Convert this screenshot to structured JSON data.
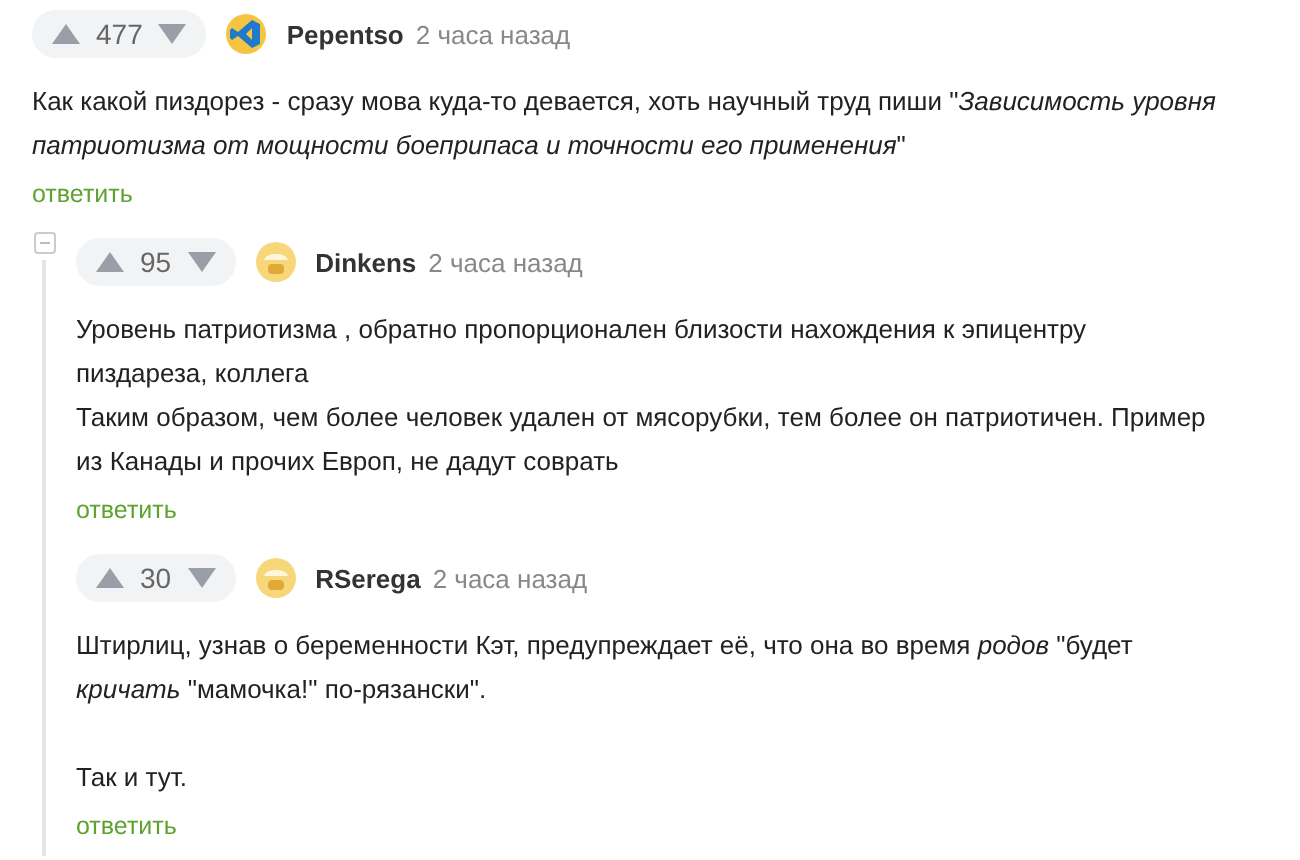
{
  "comments": [
    {
      "rating": "477",
      "author": "Pepentso",
      "avatar": {
        "kind": "code"
      },
      "time": "2 часа назад",
      "paragraphs": [
        {
          "text": "Как какой пиздорез - сразу мова куда-то девается, хоть научный труд пиши \"*Зависимость уровня патриотизма от мощности боеприпаса и точности его применения*\""
        }
      ],
      "reply": "ответить",
      "children": [
        {
          "rating": "95",
          "author": "Dinkens",
          "avatar": {
            "kind": "face"
          },
          "time": "2 часа назад",
          "paragraphs": [
            {
              "text": "Уровень патриотизма , обратно пропорционален близости нахождения к эпицентру пиздареза, коллега"
            },
            {
              "text": "Таким образом, чем более человек удален от мясорубки, тем более он патриотичен. Пример из Канады и прочих Европ, не дадут соврать"
            }
          ],
          "reply": "ответить"
        },
        {
          "rating": "30",
          "author": "RSerega",
          "avatar": {
            "kind": "face"
          },
          "time": "2 часа назад",
          "paragraphs": [
            {
              "text": "Штирлиц, узнав о беременности Кэт, предупреждает её, что она во время *родов* \"будет *кричать* \"мамочка!\" по-рязански\"."
            },
            {
              "text": "Так и тут.",
              "gap_before": true
            }
          ],
          "reply": "ответить"
        }
      ]
    }
  ]
}
